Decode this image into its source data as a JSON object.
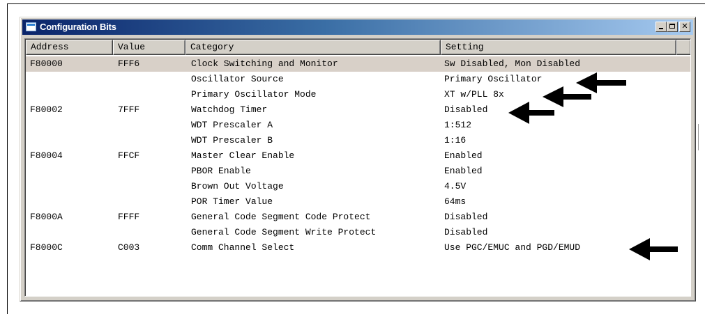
{
  "window": {
    "title": "Configuration Bits",
    "minimize_glyph": "",
    "maximize_glyph": "",
    "close_glyph": "✕"
  },
  "columns": [
    "Address",
    "Value",
    "Category",
    "Setting"
  ],
  "rows": [
    {
      "address": "F80000",
      "value": "FFF6",
      "category": "Clock Switching and Monitor",
      "setting": "Sw Disabled, Mon Disabled",
      "selected": true
    },
    {
      "address": "",
      "value": "",
      "category": "Oscillator Source",
      "setting": "Primary Oscillator"
    },
    {
      "address": "",
      "value": "",
      "category": "Primary Oscillator Mode",
      "setting": "XT w/PLL 8x"
    },
    {
      "address": "F80002",
      "value": "7FFF",
      "category": "Watchdog Timer",
      "setting": "Disabled"
    },
    {
      "address": "",
      "value": "",
      "category": "WDT Prescaler A",
      "setting": "1:512"
    },
    {
      "address": "",
      "value": "",
      "category": "WDT Prescaler B",
      "setting": "1:16"
    },
    {
      "address": "F80004",
      "value": "FFCF",
      "category": "Master Clear Enable",
      "setting": "Enabled"
    },
    {
      "address": "",
      "value": "",
      "category": "PBOR Enable",
      "setting": "Enabled"
    },
    {
      "address": "",
      "value": "",
      "category": "Brown Out Voltage",
      "setting": "4.5V"
    },
    {
      "address": "",
      "value": "",
      "category": "POR Timer Value",
      "setting": "64ms"
    },
    {
      "address": "F8000A",
      "value": "FFFF",
      "category": "General Code Segment Code Protect",
      "setting": "Disabled"
    },
    {
      "address": "",
      "value": "",
      "category": "General Code Segment Write Protect",
      "setting": "Disabled"
    },
    {
      "address": "F8000C",
      "value": "C003",
      "category": "Comm Channel Select",
      "setting": "Use PGC/EMUC and PGD/EMUD"
    }
  ],
  "colors": {
    "titlebar_start": "#0a246a",
    "titlebar_end": "#a6caf0",
    "selected_row": "#d8d0c8",
    "chrome": "#d4d0c8"
  },
  "icons": [
    "window-app-icon",
    "minimize-icon",
    "maximize-icon",
    "close-icon",
    "left-arrow-icon"
  ]
}
